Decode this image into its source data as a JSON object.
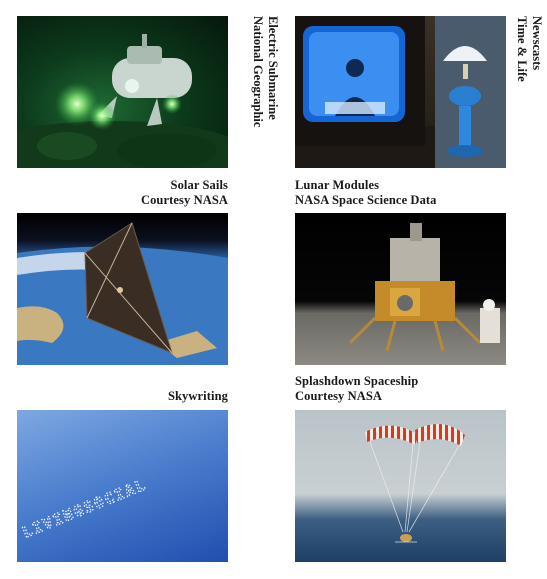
{
  "items": [
    {
      "title": "Electric Submarine",
      "credit": "National Geographic",
      "photo": "submarine-photo"
    },
    {
      "title": "Newscasts",
      "credit": "Time & Life",
      "photo": "newscast-photo"
    },
    {
      "title": "Solar Sails",
      "credit": "Courtesy NASA",
      "photo": "solar-sail-photo"
    },
    {
      "title": "Lunar Modules",
      "credit": "NASA Space Science Data",
      "photo": "lunar-module-photo"
    },
    {
      "title": "Skywriting",
      "credit": "",
      "photo": "skywriting-photo"
    },
    {
      "title": "Splashdown Spaceship",
      "credit": "Courtesy NASA",
      "photo": "splashdown-photo"
    }
  ],
  "skywriting_text": "LIVINGSOCIAL"
}
